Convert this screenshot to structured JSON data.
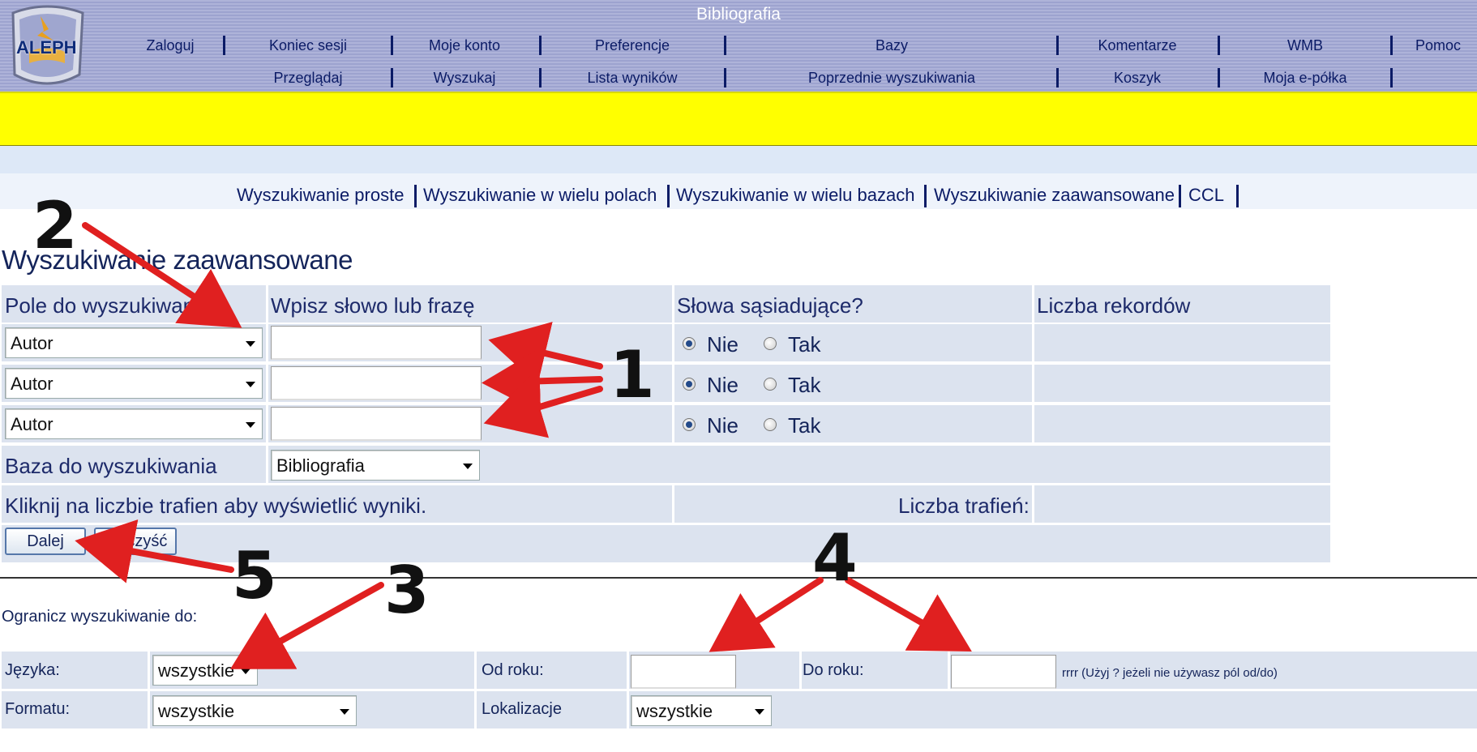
{
  "header": {
    "title": "Bibliografia",
    "logo_text": "ALEPH",
    "nav_row1": [
      "Zaloguj",
      "Koniec sesji",
      "Moje konto",
      "Preferencje",
      "Bazy",
      "Komentarze",
      "WMB",
      "Pomoc"
    ],
    "nav_row2": [
      "Przeglądaj",
      "Wyszukaj",
      "Lista wyników",
      "Poprzednie wyszukiwania",
      "Koszyk",
      "Moja e-półka"
    ]
  },
  "subnav": [
    "Wyszukiwanie proste",
    "Wyszukiwanie w wielu polach",
    "Wyszukiwanie w wielu bazach",
    "Wyszukiwanie zaawansowane",
    "CCL"
  ],
  "page_title": "Wyszukiwanie zaawansowane",
  "form": {
    "col_headers": [
      "Pole do wyszukiwania",
      "Wpisz słowo lub frazę",
      "Słowa sąsiadujące?",
      "Liczba rekordów"
    ],
    "rows": [
      {
        "field": "Autor",
        "query": "",
        "adjacent": "Nie"
      },
      {
        "field": "Autor",
        "query": "",
        "adjacent": "Nie"
      },
      {
        "field": "Autor",
        "query": "",
        "adjacent": "Nie"
      }
    ],
    "radio_no": "Nie",
    "radio_yes": "Tak",
    "base_label": "Baza do wyszukiwania",
    "base_value": "Bibliografia",
    "hint": "Kliknij na liczbie trafien aby wyświetlić wyniki.",
    "hits_label": "Liczba trafień:",
    "next_button": "Dalej",
    "clear_button": "Wyczyść"
  },
  "limit": {
    "title": "Ogranicz wyszukiwanie do:",
    "language_label": "Języka:",
    "language_value": "wszystkie",
    "format_label": "Formatu:",
    "format_value": "wszystkie",
    "from_year_label": "Od roku:",
    "to_year_label": "Do roku:",
    "year_hint": "rrrr (Użyj ? jeżeli nie używasz pól od/do)",
    "location_label": "Lokalizacje",
    "location_value": "wszystkie"
  },
  "annotations": [
    "1",
    "2",
    "3",
    "4",
    "5"
  ],
  "colors": {
    "header": "#aeb3d9",
    "banner": "#ffff00",
    "arrow": "#e02020",
    "cell": "#dce3ef"
  }
}
